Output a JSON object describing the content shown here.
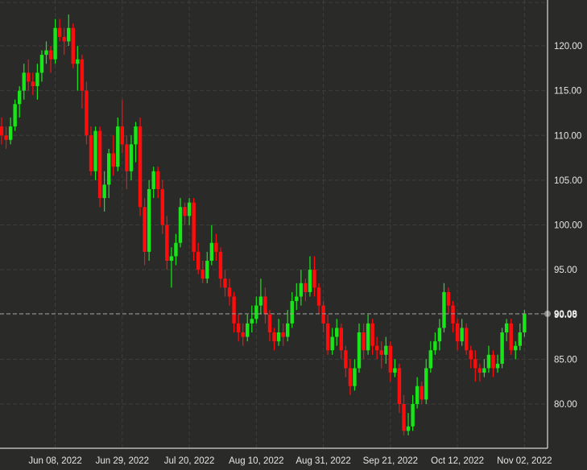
{
  "chart_data": {
    "type": "candlestick",
    "title": "",
    "xlabel": "",
    "ylabel": "",
    "ylim": [
      75,
      125
    ],
    "grid": true,
    "colors": {
      "up": "#19e619",
      "down": "#ff0d0d",
      "background": "#2a2b29",
      "grid": "#3d3e3b",
      "axis": "#ffffff",
      "current": "#9a9a9a"
    },
    "y_ticks": [
      "80.00",
      "85.00",
      "90.00",
      "95.00",
      "100.00",
      "105.00",
      "110.00",
      "115.00",
      "120.00"
    ],
    "x_ticks": [
      {
        "label": "Jun 08, 2022",
        "index": 12
      },
      {
        "label": "Jun 29, 2022",
        "index": 27
      },
      {
        "label": "Jul 20, 2022",
        "index": 42
      },
      {
        "label": "Aug 10, 2022",
        "index": 57
      },
      {
        "label": "Aug 31, 2022",
        "index": 72
      },
      {
        "label": "Sep 21, 2022",
        "index": 87
      },
      {
        "label": "Oct 12, 2022",
        "index": 102
      },
      {
        "label": "Nov 02, 2022",
        "index": 117
      }
    ],
    "current_price": 90.08,
    "current_price_label": "90.08",
    "ohlc": [
      [
        111,
        112,
        109,
        110
      ],
      [
        110,
        111,
        108.5,
        109.5
      ],
      [
        109.5,
        112,
        109,
        111
      ],
      [
        111,
        114,
        110.5,
        113.5
      ],
      [
        113.5,
        115.5,
        112,
        115
      ],
      [
        115,
        118,
        114,
        117
      ],
      [
        117,
        118.5,
        115,
        116
      ],
      [
        116,
        117,
        114.5,
        115.5
      ],
      [
        115.5,
        118,
        114,
        117
      ],
      [
        117,
        119.5,
        116,
        119
      ],
      [
        119,
        120.5,
        118,
        119.5
      ],
      [
        119.5,
        120,
        117,
        118.5
      ],
      [
        118.5,
        123,
        118,
        122
      ],
      [
        122,
        123,
        120.5,
        121
      ],
      [
        121,
        122,
        119,
        120.5
      ],
      [
        120.5,
        123.5,
        120,
        122
      ],
      [
        122,
        122.5,
        117.5,
        118
      ],
      [
        118,
        120,
        115,
        118.5
      ],
      [
        118.5,
        119,
        113,
        115
      ],
      [
        115,
        116,
        109,
        110
      ],
      [
        110,
        111,
        105.5,
        106
      ],
      [
        106,
        111,
        105,
        110.5
      ],
      [
        110.5,
        111,
        102,
        103
      ],
      [
        103,
        106,
        101.5,
        104.5
      ],
      [
        104.5,
        108.5,
        103,
        108
      ],
      [
        108,
        110,
        105.5,
        106.5
      ],
      [
        106.5,
        112,
        106,
        111
      ],
      [
        111,
        114,
        108,
        109
      ],
      [
        109,
        110,
        104,
        106
      ],
      [
        106,
        110,
        105,
        109
      ],
      [
        109,
        111.5,
        107,
        111
      ],
      [
        111,
        112,
        101,
        102
      ],
      [
        102,
        103,
        95.5,
        97
      ],
      [
        97,
        105,
        96,
        104
      ],
      [
        104,
        106.5,
        103,
        106
      ],
      [
        106,
        106.5,
        103,
        104
      ],
      [
        104,
        105,
        99,
        100
      ],
      [
        100,
        101,
        95,
        96
      ],
      [
        96,
        97.5,
        93,
        96.5
      ],
      [
        96.5,
        99,
        95.5,
        98
      ],
      [
        98,
        103,
        97.5,
        102
      ],
      [
        102,
        102.5,
        100,
        101
      ],
      [
        101,
        103,
        100,
        102.5
      ],
      [
        102.5,
        103,
        96,
        97
      ],
      [
        97,
        98,
        94.5,
        95
      ],
      [
        95,
        96,
        93.5,
        94
      ],
      [
        94,
        97,
        93.5,
        96
      ],
      [
        96,
        100,
        95.5,
        98
      ],
      [
        98,
        99,
        96,
        97
      ],
      [
        97,
        97.5,
        93,
        94
      ],
      [
        94,
        95,
        92,
        93
      ],
      [
        93,
        94,
        91,
        92
      ],
      [
        92,
        92.5,
        88,
        89
      ],
      [
        89,
        90,
        87,
        88
      ],
      [
        88,
        89,
        86.5,
        87.5
      ],
      [
        87.5,
        90,
        87,
        89
      ],
      [
        89,
        91,
        88,
        89.5
      ],
      [
        89.5,
        92,
        89,
        91
      ],
      [
        91,
        94,
        90,
        92
      ],
      [
        92,
        93,
        89,
        90
      ],
      [
        90,
        90.5,
        87,
        88
      ],
      [
        88,
        88.5,
        86,
        87
      ],
      [
        87,
        89.5,
        86.5,
        88
      ],
      [
        88,
        89,
        86.5,
        87.5
      ],
      [
        87.5,
        90.5,
        87,
        89
      ],
      [
        89,
        92.5,
        88.5,
        91.5
      ],
      [
        91.5,
        93.5,
        90.5,
        92
      ],
      [
        92,
        95,
        91,
        93.5
      ],
      [
        93.5,
        94,
        91.5,
        92.5
      ],
      [
        92.5,
        96.5,
        92,
        95
      ],
      [
        95,
        96.5,
        92,
        93
      ],
      [
        93,
        93.5,
        90,
        91
      ],
      [
        91,
        91.5,
        88,
        89
      ],
      [
        89,
        90,
        85.5,
        86
      ],
      [
        86,
        88.5,
        85.5,
        87.5
      ],
      [
        87.5,
        89.5,
        86.5,
        88.5
      ],
      [
        88.5,
        89,
        85,
        86
      ],
      [
        86,
        86.5,
        83,
        84
      ],
      [
        84,
        85,
        81,
        82
      ],
      [
        82,
        85,
        81.5,
        84
      ],
      [
        84,
        89,
        83.5,
        88
      ],
      [
        88,
        89,
        85,
        86
      ],
      [
        86,
        90,
        85.5,
        89
      ],
      [
        89,
        89.5,
        85.5,
        86.5
      ],
      [
        86.5,
        87.5,
        85,
        86
      ],
      [
        86,
        87,
        84,
        85.5
      ],
      [
        85.5,
        87.5,
        84.5,
        86.5
      ],
      [
        86.5,
        87,
        82.5,
        83.5
      ],
      [
        83.5,
        85,
        83,
        84
      ],
      [
        84,
        84.5,
        79,
        80
      ],
      [
        80,
        81,
        76.5,
        77
      ],
      [
        77,
        79,
        76.5,
        77.5
      ],
      [
        77.5,
        81,
        77,
        80
      ],
      [
        80,
        83,
        79.5,
        82
      ],
      [
        82,
        82.5,
        80,
        80.5
      ],
      [
        80.5,
        85,
        80,
        84
      ],
      [
        84,
        87,
        83.5,
        86
      ],
      [
        86,
        88,
        85.5,
        87
      ],
      [
        87,
        89.5,
        86,
        88.5
      ],
      [
        88.5,
        93.5,
        88,
        92.5
      ],
      [
        92.5,
        93,
        90,
        91
      ],
      [
        91,
        91.5,
        88,
        89
      ],
      [
        89,
        89.5,
        86,
        87
      ],
      [
        87,
        89.5,
        86.5,
        88.5
      ],
      [
        88.5,
        89,
        85.5,
        86
      ],
      [
        86,
        86.5,
        84,
        85
      ],
      [
        85,
        86,
        82.5,
        84
      ],
      [
        84,
        84.5,
        82.5,
        83.5
      ],
      [
        83.5,
        85,
        83,
        84
      ],
      [
        84,
        86.5,
        83.5,
        85.5
      ],
      [
        85.5,
        86,
        83,
        84
      ],
      [
        84,
        85.5,
        83.5,
        84.5
      ],
      [
        84.5,
        88.5,
        84,
        88
      ],
      [
        88,
        89.5,
        87,
        89
      ],
      [
        89,
        89.5,
        85.5,
        86
      ],
      [
        86,
        87,
        85,
        86.5
      ],
      [
        86.5,
        89,
        86,
        88
      ],
      [
        88,
        90.5,
        87.5,
        90.08
      ]
    ]
  }
}
